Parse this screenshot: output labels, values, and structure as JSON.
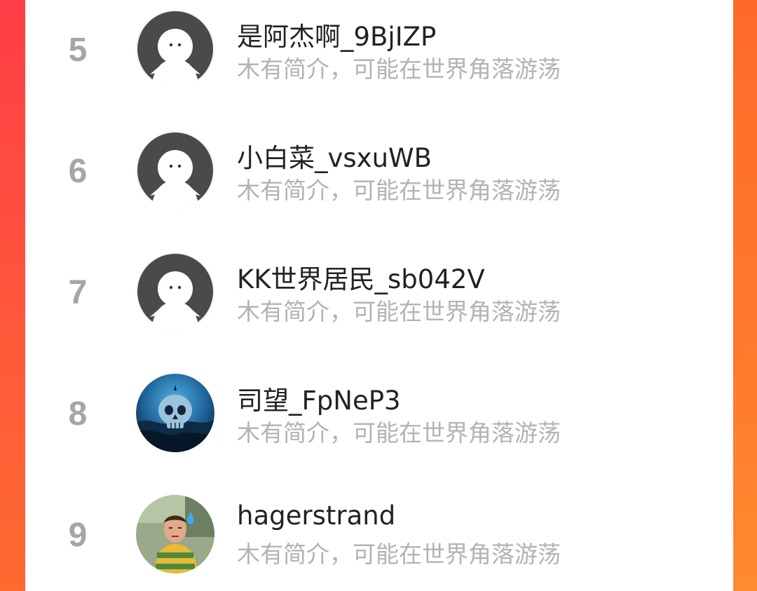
{
  "users": [
    {
      "rank": "5",
      "name": "是阿杰啊_9BjIZP",
      "bio": "木有简介，可能在世界角落游荡",
      "avatar": "default-avatar-icon"
    },
    {
      "rank": "6",
      "name": "小白菜_vsxuWB",
      "bio": "木有简介，可能在世界角落游荡",
      "avatar": "default-avatar-icon"
    },
    {
      "rank": "7",
      "name": "KK世界居民_sb042V",
      "bio": "木有简介，可能在世界角落游荡",
      "avatar": "default-avatar-icon"
    },
    {
      "rank": "8",
      "name": "司望_FpNeP3",
      "bio": "木有简介，可能在世界角落游荡",
      "avatar": "skull-avatar-icon"
    },
    {
      "rank": "9",
      "name": "hagerstrand",
      "bio": "木有简介，可能在世界角落游荡",
      "avatar": "cartoon-character-avatar-icon"
    }
  ],
  "colors": {
    "background_accent": "#ff5a3a",
    "rank_text": "#a6a6a6",
    "name_text": "#222222",
    "bio_text": "#b3b3b3"
  }
}
